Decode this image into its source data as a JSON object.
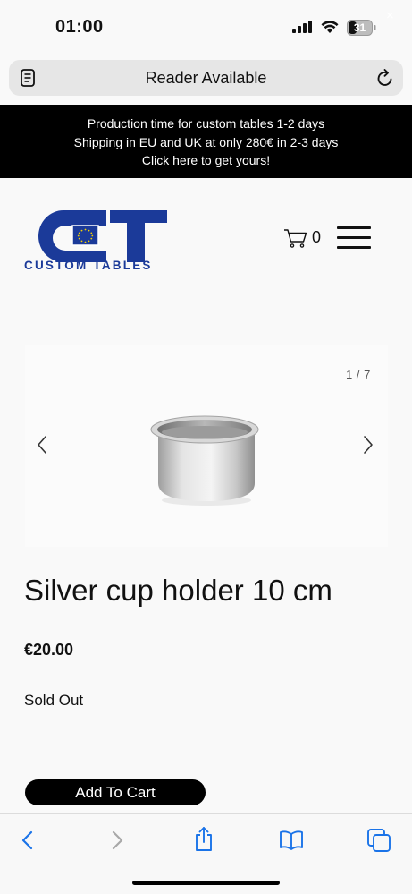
{
  "status_bar": {
    "time": "01:00",
    "battery_level": "31",
    "icons": [
      "cellular-signal-icon",
      "wifi-icon",
      "battery-icon"
    ]
  },
  "browser": {
    "address_text": "Reader Available",
    "icons": [
      "reader-icon",
      "reload-icon"
    ]
  },
  "promo": {
    "lines": [
      "Production time for custom tables 1-2 days",
      "Shipping in EU and UK at only 280€ in 2-3 days",
      "Click here to get yours!"
    ],
    "close": "×"
  },
  "header": {
    "brand": "CUSTOM TABLES",
    "cart_count": "0",
    "brand_color": "#1b3a99"
  },
  "gallery": {
    "counter": "1 / 7"
  },
  "product": {
    "title": "Silver cup holder 10 cm",
    "price": "€20.00",
    "stock_status": "Sold Out",
    "add_to_cart": "Add To Cart"
  },
  "toolbar": {
    "icons": [
      "back-icon",
      "forward-icon",
      "share-icon",
      "bookmarks-icon",
      "tabs-icon"
    ],
    "accent": "#1a73e8"
  }
}
